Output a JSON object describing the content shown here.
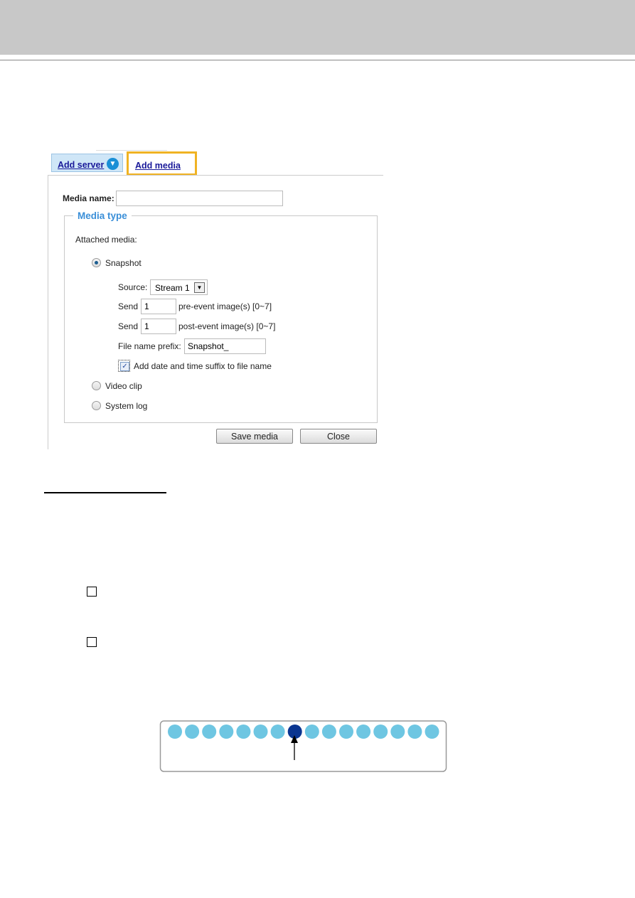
{
  "tabs": [
    {
      "label": "Add server",
      "icon": "chevron-down-circle-icon"
    },
    {
      "label": "Add media",
      "highlighted": true
    }
  ],
  "form": {
    "media_name_label": "Media name:",
    "media_name_value": "",
    "media_type_legend": "Media type",
    "attached_media_label": "Attached media:",
    "options": [
      {
        "label": "Snapshot",
        "selected": true
      },
      {
        "label": "Video clip",
        "selected": false
      },
      {
        "label": "System log",
        "selected": false
      }
    ],
    "source_label": "Source:",
    "source_value": "Stream 1",
    "send_label": "Send",
    "pre_event_value": "1",
    "pre_event_label": "pre-event image(s) [0~7]",
    "post_event_value": "1",
    "post_event_label": "post-event image(s) [0~7]",
    "prefix_label": "File name prefix:",
    "prefix_value": "Snapshot_",
    "suffix_label": "Add date and time suffix to file name",
    "suffix_checked": true,
    "save_label": "Save media",
    "close_label": "Close"
  },
  "diagram": {
    "total_images": 16,
    "highlighted_index": 7,
    "colors": {
      "light": "#6ec6e2",
      "highlight": "#0a3590"
    }
  }
}
